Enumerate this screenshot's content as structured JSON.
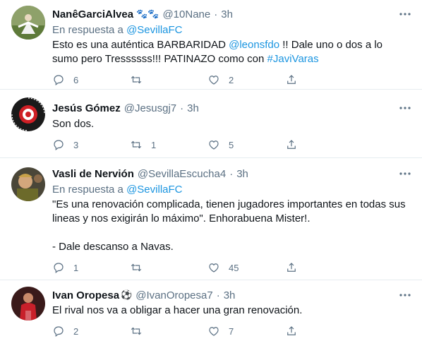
{
  "tweets": [
    {
      "name": "NanêGarciAlvea",
      "emoji": "🐾🐾",
      "handle": "@10Nane",
      "dot": "·",
      "time": "3h",
      "reply_prefix": "En respuesta a",
      "reply_to": "@SevillaFC",
      "text": {
        "p1": "Esto es una auténtica BARBARIDAD ",
        "m1": "@leonsfdo",
        "p2": " !! Dale uno o dos a lo sumo pero Tressssss!!!  PATINAZO como con ",
        "h1": "#JaviVaras"
      },
      "replies": "6",
      "retweets": "",
      "likes": "2"
    },
    {
      "name": "Jesús Gómez",
      "handle": "@Jesusgj7",
      "dot": "·",
      "time": "3h",
      "text": "Son dos.",
      "replies": "3",
      "retweets": "1",
      "likes": "5"
    },
    {
      "name": "Vasli de Nervión",
      "handle": "@SevillaEscucha4",
      "dot": "·",
      "time": "3h",
      "reply_prefix": "En respuesta a",
      "reply_to": "@SevillaFC",
      "text_lines": [
        "\"Es una renovación complicada, tienen jugadores importantes en todas sus lineas y nos exigirán lo máximo\". Enhorabuena Mister!.",
        "- Dale descanso a Navas."
      ],
      "replies": "1",
      "retweets": "",
      "likes": "45"
    },
    {
      "name": "Ivan Oropesa",
      "emoji": "⚽",
      "handle": "@IvanOropesa7",
      "dot": "·",
      "time": "3h",
      "text": "El rival nos va a obligar a hacer una gran renovación.",
      "replies": "2",
      "retweets": "",
      "likes": "7"
    }
  ],
  "icons": {
    "reply": "reply-icon",
    "retweet": "retweet-icon",
    "like": "heart-icon",
    "share": "share-icon",
    "more": "more-icon"
  },
  "colors": {
    "link": "#1b95e0",
    "secondary_text": "#5b7083",
    "divider": "#e6ecf0"
  }
}
